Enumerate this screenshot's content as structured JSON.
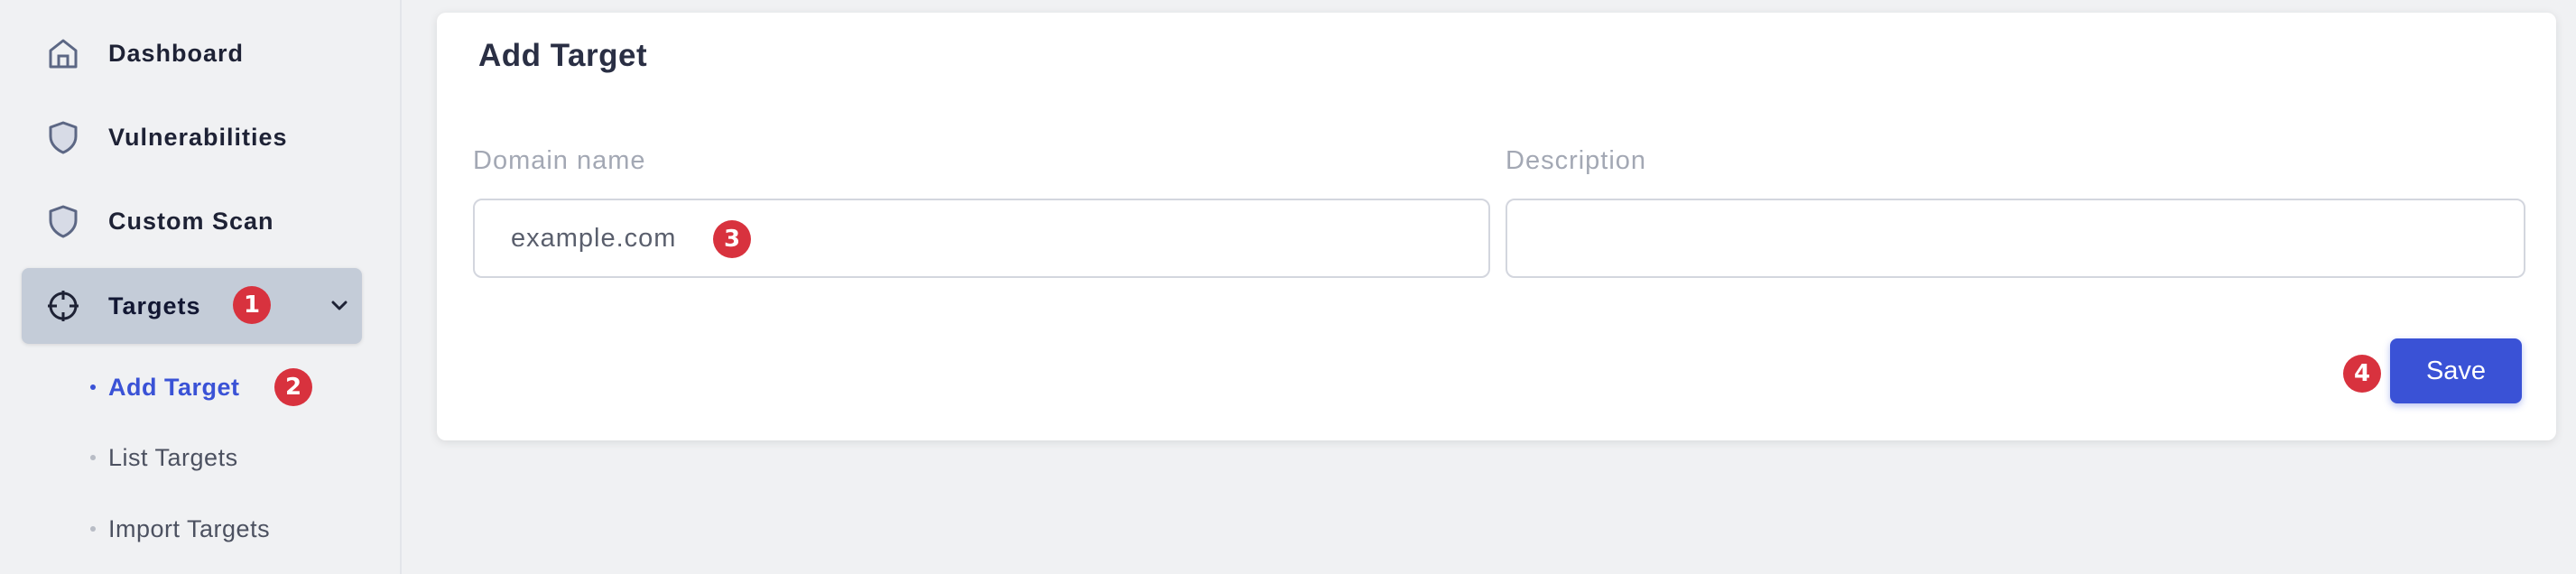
{
  "sidebar": {
    "items": [
      {
        "label": "Dashboard",
        "icon": "home-icon"
      },
      {
        "label": "Vulnerabilities",
        "icon": "shield-icon"
      },
      {
        "label": "Custom Scan",
        "icon": "shield-icon"
      },
      {
        "label": "Targets",
        "icon": "crosshair-icon",
        "badge": "1",
        "expanded": true
      }
    ],
    "sub_items": [
      {
        "label": "Add Target",
        "badge": "2",
        "active": true
      },
      {
        "label": "List Targets"
      },
      {
        "label": "Import Targets"
      }
    ]
  },
  "form": {
    "title": "Add Target",
    "domain_label": "Domain name",
    "domain_placeholder": "example.com",
    "domain_badge": "3",
    "description_label": "Description",
    "description_value": "",
    "save_badge": "4",
    "save_label": "Save"
  },
  "colors": {
    "accent": "#3a52d6",
    "badge": "#d8323e",
    "active_nav": "#c4ccd8"
  }
}
